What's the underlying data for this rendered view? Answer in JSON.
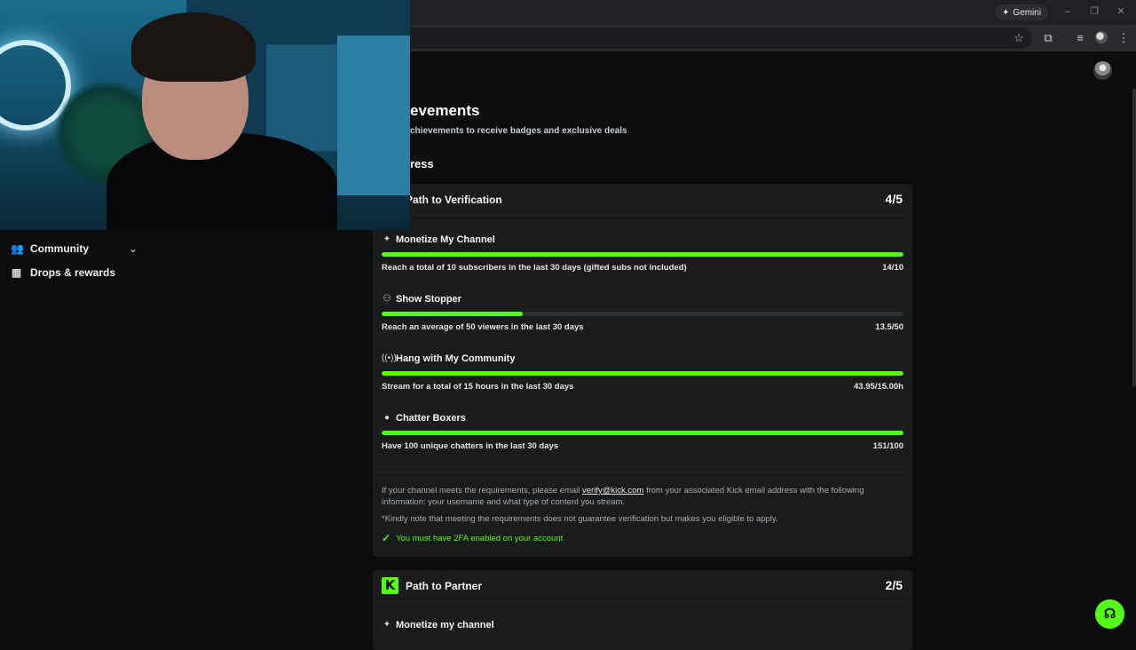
{
  "browser": {
    "gemini_label": "Gemini"
  },
  "sidebar": {
    "items": [
      {
        "label": "Community",
        "icon": "community-icon"
      },
      {
        "label": "Drops & rewards",
        "icon": "drops-icon"
      }
    ]
  },
  "page": {
    "title": "evements",
    "subtitle": "chievements to receive badges and exclusive deals",
    "section": "ress"
  },
  "verification": {
    "title": "Path to Verification",
    "count": "4/5",
    "tasks": [
      {
        "name": "Monetize My Channel",
        "icon": "sparkle-icon",
        "desc": "Reach a total of 10 subscribers in the last 30 days (gifted subs not included)",
        "value": "14/10",
        "progress": 1.0
      },
      {
        "name": "Show Stopper",
        "icon": "viewers-icon",
        "desc": "Reach an average of 50 viewers in the last 30 days",
        "value": "13.5/50",
        "progress": 0.27
      },
      {
        "name": "Hang with My Community",
        "icon": "broadcast-icon",
        "desc": "Stream for a total of 15 hours in the last 30 days",
        "value": "43.95/15.00h",
        "progress": 1.0
      },
      {
        "name": "Chatter Boxers",
        "icon": "chat-icon",
        "desc": "Have 100 unique chatters in the last 30 days",
        "value": "151/100",
        "progress": 1.0
      }
    ],
    "note_pre": "If your channel meets the requirements, please email",
    "note_email": "verify@kick.com",
    "note_post": "from your associated Kick email address with the following information: your username and what type of content you stream.",
    "disclaimer": "*Kindly note that meeting the requirements does not guarantee verification but makes you eligible to apply.",
    "requirement": "You must have 2FA enabled on your account"
  },
  "partner": {
    "title": "Path to Partner",
    "count": "2/5",
    "logo_letter": "K",
    "first_task": "Monetize my channel"
  },
  "colors": {
    "accent": "#53fc18",
    "card_bg": "#191b1c",
    "page_bg": "#0b0c0d"
  }
}
